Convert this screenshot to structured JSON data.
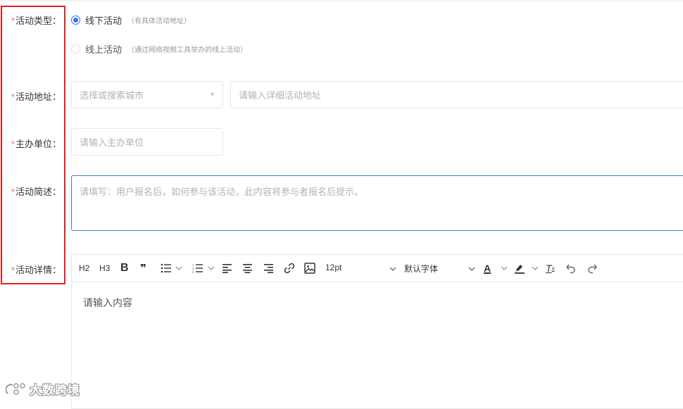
{
  "form": {
    "required_mark": "*",
    "activity_type": {
      "label": "活动类型：",
      "options": [
        {
          "label": "线下活动",
          "hint": "（有具体活动地址）",
          "checked": true
        },
        {
          "label": "线上活动",
          "hint": "（通过网络视频工具举办的线上活动）",
          "checked": false
        }
      ]
    },
    "address": {
      "label": "活动地址：",
      "city_placeholder": "选择或搜索城市",
      "detail_placeholder": "请输入详细活动地址"
    },
    "organizer": {
      "label": "主办单位：",
      "placeholder": "请输入主办单位"
    },
    "summary": {
      "label": "活动简述：",
      "placeholder": "请填写：用户报名后，如何参与该活动，此内容将参与者报名后提示。"
    },
    "details": {
      "label": "活动详情：",
      "toolbar": {
        "h2": "H2",
        "h3": "H3",
        "bold": "B",
        "quote": "❞",
        "font_size": "12pt",
        "font_family": "默认字体",
        "font_color_letter": "A",
        "clear_format_letter": "T"
      },
      "placeholder": "请输入内容"
    }
  },
  "watermark": {
    "text": "大数跨境"
  },
  "colors": {
    "accent": "#3370ff",
    "required": "#f56c6c",
    "highlight_border": "#e02020"
  }
}
